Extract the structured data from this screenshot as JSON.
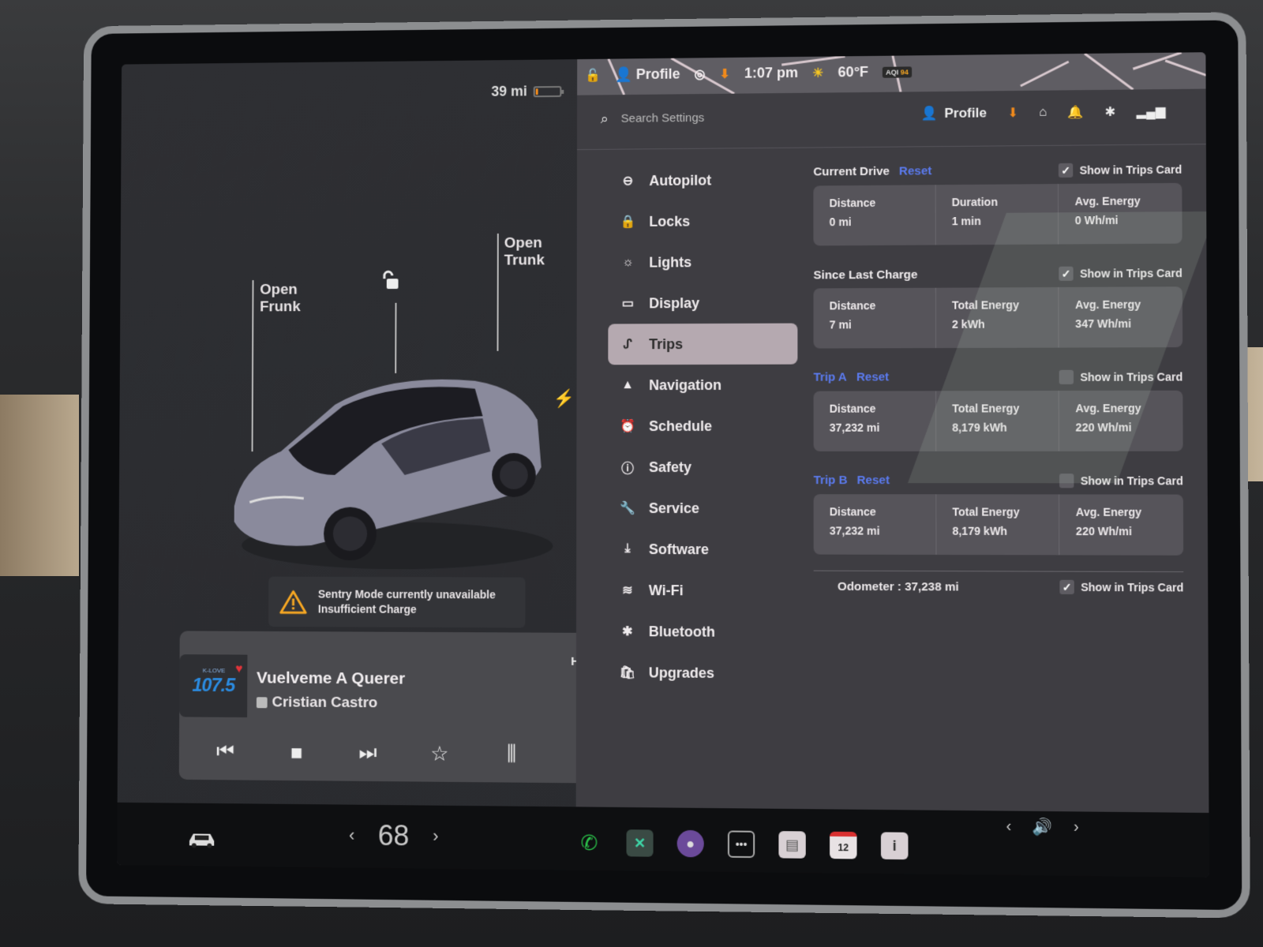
{
  "status": {
    "range": "39 mi",
    "battery_level_percent": 8,
    "profile_label": "Profile",
    "time": "1:07 pm",
    "temperature": "60°F",
    "aqi_label": "AQI",
    "aqi_value": "94"
  },
  "vehicle": {
    "open_frunk_line1": "Open",
    "open_frunk_line2": "Frunk",
    "open_trunk_line1": "Open",
    "open_trunk_line2": "Trunk"
  },
  "alert": {
    "title": "Sentry Mode currently unavailable",
    "subtitle": "Insufficient Charge",
    "warning_color": "#f5a623"
  },
  "media": {
    "station_brand": "K-LOVE",
    "station_freq": "107.5",
    "song_title": "Vuelveme A Querer",
    "artist": "Cristian Castro",
    "hd_label": "HD"
  },
  "climate": {
    "temperature": "68"
  },
  "settings": {
    "search_placeholder": "Search Settings",
    "profile_label": "Profile",
    "nav": [
      {
        "label": "Autopilot",
        "icon": "steering-wheel"
      },
      {
        "label": "Locks",
        "icon": "lock"
      },
      {
        "label": "Lights",
        "icon": "sun"
      },
      {
        "label": "Display",
        "icon": "display"
      },
      {
        "label": "Trips",
        "icon": "trips",
        "active": true
      },
      {
        "label": "Navigation",
        "icon": "navigation-arrow"
      },
      {
        "label": "Schedule",
        "icon": "alarm-clock"
      },
      {
        "label": "Safety",
        "icon": "alert-circle"
      },
      {
        "label": "Service",
        "icon": "wrench"
      },
      {
        "label": "Software",
        "icon": "download"
      },
      {
        "label": "Wi-Fi",
        "icon": "wifi"
      },
      {
        "label": "Bluetooth",
        "icon": "bluetooth"
      },
      {
        "label": "Upgrades",
        "icon": "shopping-bag"
      }
    ],
    "reset_label": "Reset",
    "show_in_trips_card": "Show in Trips Card",
    "current_drive": {
      "title": "Current Drive",
      "show_checked": true,
      "stats": [
        {
          "label": "Distance",
          "value": "0 mi"
        },
        {
          "label": "Duration",
          "value": "1 min"
        },
        {
          "label": "Avg. Energy",
          "value": "0 Wh/mi"
        }
      ]
    },
    "since_last_charge": {
      "title": "Since Last Charge",
      "show_checked": true,
      "stats": [
        {
          "label": "Distance",
          "value": "7 mi"
        },
        {
          "label": "Total Energy",
          "value": "2 kWh"
        },
        {
          "label": "Avg. Energy",
          "value": "347 Wh/mi"
        }
      ]
    },
    "trip_a": {
      "title": "Trip A",
      "show_checked": false,
      "stats": [
        {
          "label": "Distance",
          "value": "37,232 mi"
        },
        {
          "label": "Total Energy",
          "value": "8,179 kWh"
        },
        {
          "label": "Avg. Energy",
          "value": "220 Wh/mi"
        }
      ]
    },
    "trip_b": {
      "title": "Trip B",
      "show_checked": false,
      "stats": [
        {
          "label": "Distance",
          "value": "37,232 mi"
        },
        {
          "label": "Total Energy",
          "value": "8,179 kWh"
        },
        {
          "label": "Avg. Energy",
          "value": "220 Wh/mi"
        }
      ]
    },
    "odometer": {
      "text": "Odometer : 37,238 mi",
      "show_checked": true
    }
  },
  "dock": {
    "calendar_day": "12"
  },
  "colors": {
    "accent_blue": "#5b7bf0",
    "orange": "#f08a1c",
    "phone_green": "#2bc24a"
  }
}
